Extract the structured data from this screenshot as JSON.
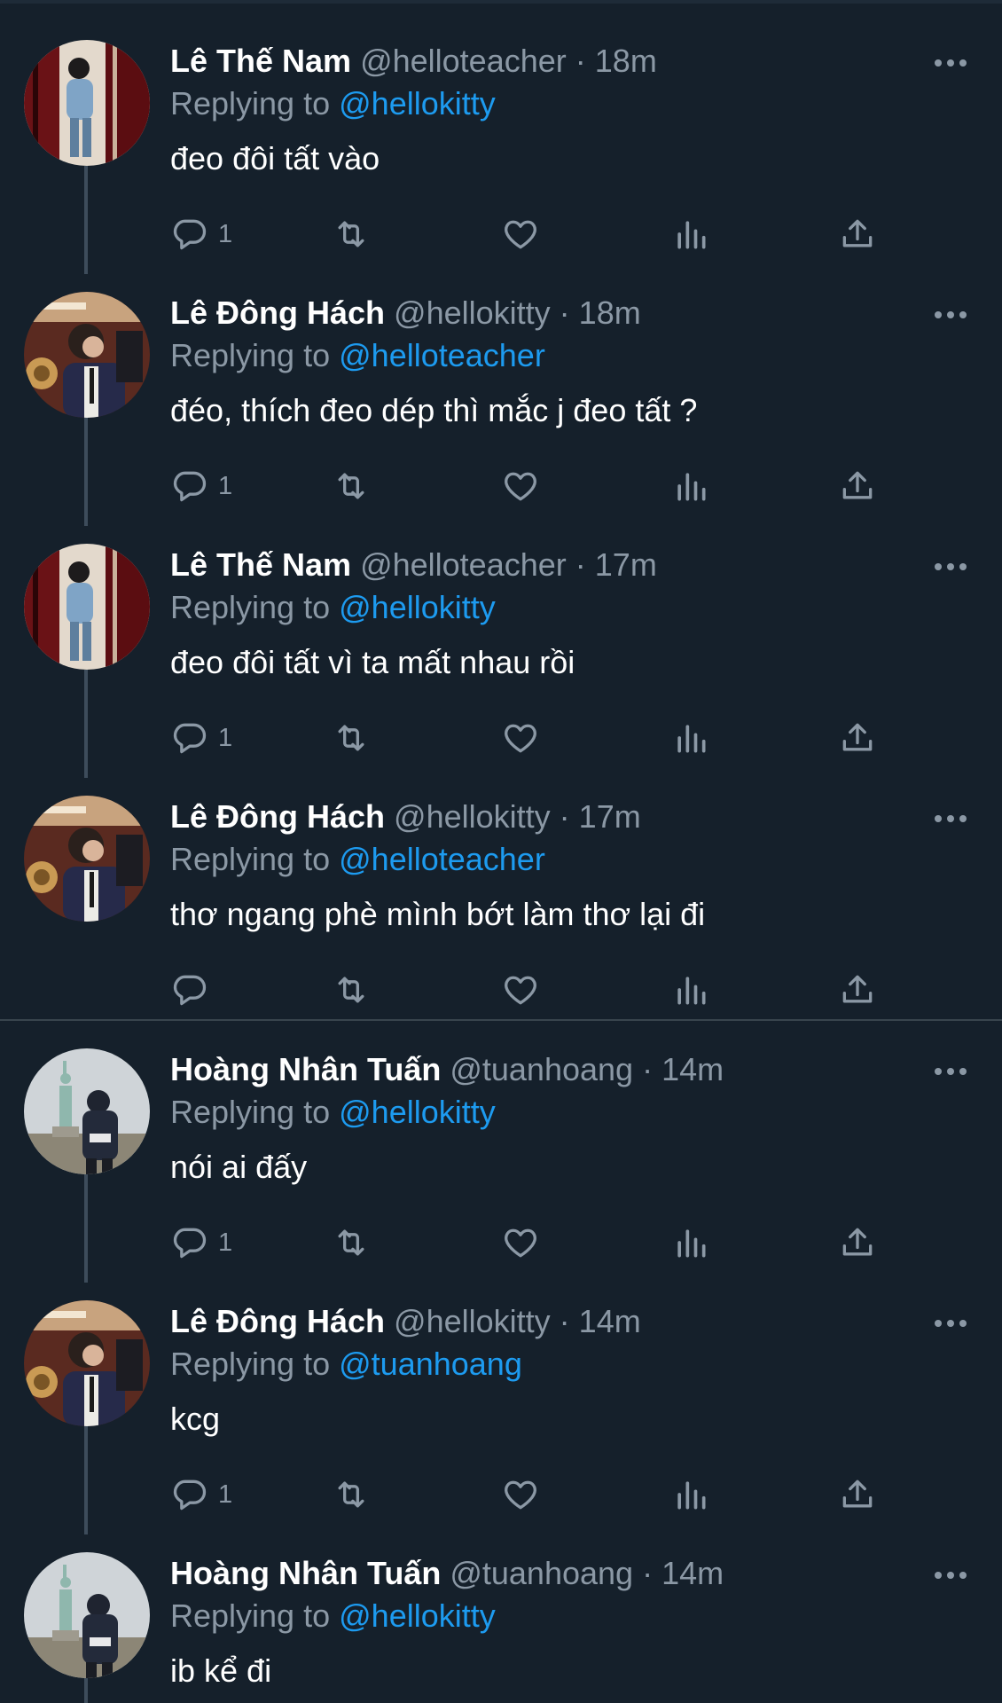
{
  "tweets": [
    {
      "name": "Lê Thế Nam",
      "handle": "@helloteacher",
      "sep": "·",
      "time": "18m",
      "replying_label": "Replying to",
      "replying_to": "@hellokitty",
      "text": "đeo đôi tất vào",
      "reply_count": "1",
      "avatar": "nam"
    },
    {
      "name": "Lê Đông Hách",
      "handle": "@hellokitty",
      "sep": "·",
      "time": "18m",
      "replying_label": "Replying to",
      "replying_to": "@helloteacher",
      "text": "đéo, thích đeo dép thì mắc j đeo tất ?",
      "reply_count": "1",
      "avatar": "hach"
    },
    {
      "name": "Lê Thế Nam",
      "handle": "@helloteacher",
      "sep": "·",
      "time": "17m",
      "replying_label": "Replying to",
      "replying_to": "@hellokitty",
      "text": "đeo đôi tất vì ta mất nhau rồi",
      "reply_count": "1",
      "avatar": "nam"
    },
    {
      "name": "Lê Đông Hách",
      "handle": "@hellokitty",
      "sep": "·",
      "time": "17m",
      "replying_label": "Replying to",
      "replying_to": "@helloteacher",
      "text": "thơ ngang phè mình bớt làm thơ lại đi",
      "reply_count": "",
      "avatar": "hach"
    },
    {
      "name": "Hoàng Nhân Tuấn",
      "handle": "@tuanhoang",
      "sep": "·",
      "time": "14m",
      "replying_label": "Replying to",
      "replying_to": "@hellokitty",
      "text": "nói ai đấy",
      "reply_count": "1",
      "avatar": "tuan"
    },
    {
      "name": "Lê Đông Hách",
      "handle": "@hellokitty",
      "sep": "·",
      "time": "14m",
      "replying_label": "Replying to",
      "replying_to": "@tuanhoang",
      "text": "kcg",
      "reply_count": "1",
      "avatar": "hach"
    },
    {
      "name": "Hoàng Nhân Tuấn",
      "handle": "@tuanhoang",
      "sep": "·",
      "time": "14m",
      "replying_label": "Replying to",
      "replying_to": "@hellokitty",
      "text": "ib kể đi",
      "reply_count": "",
      "avatar": "tuan"
    }
  ],
  "colors": {
    "background": "#15202b",
    "primary_text": "#ffffff",
    "secondary_text": "#8b98a5",
    "link": "#1d9bf0",
    "thread_line": "#3d4c5b"
  },
  "icons": [
    "reply-icon",
    "retweet-icon",
    "like-icon",
    "views-icon",
    "share-icon",
    "more-icon"
  ]
}
